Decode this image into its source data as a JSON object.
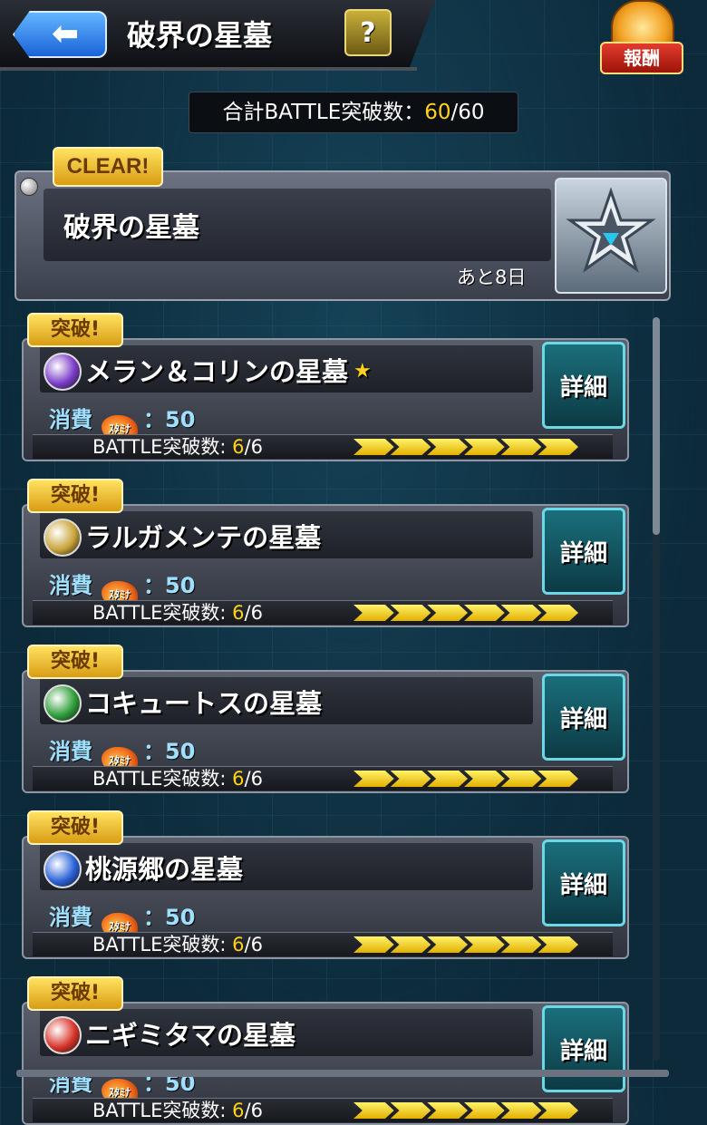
{
  "header": {
    "back_label": "⬅",
    "title": "破界の星墓",
    "help_label": "?",
    "reward_label": "報酬"
  },
  "total": {
    "label": "合計BATTLE突破数：",
    "current": "60",
    "max": "/60"
  },
  "event": {
    "clear_badge": "CLEAR!",
    "title": "破界の星墓",
    "remaining": "あと8日"
  },
  "stages": [
    {
      "badge": "突破!",
      "name": "メラン＆コリンの星墓",
      "star": "★",
      "cost_label": "消費",
      "stamina_text": "ｽﾀﾐﾅ",
      "cost_value": "：50",
      "battle_label": "BATTLE突破数: ",
      "battle_current": "6",
      "battle_max": "/6",
      "progress": 1.0,
      "detail_label": "詳細",
      "icon": "purple-element-icon",
      "icon_color": "#7a3cc8"
    },
    {
      "badge": "突破!",
      "name": "ラルガメンテの星墓",
      "star": "",
      "cost_label": "消費",
      "stamina_text": "ｽﾀﾐﾅ",
      "cost_value": "：50",
      "battle_label": "BATTLE突破数: ",
      "battle_current": "6",
      "battle_max": "/6",
      "progress": 1.0,
      "detail_label": "詳細",
      "icon": "light-element-icon",
      "icon_color": "#c9a43a"
    },
    {
      "badge": "突破!",
      "name": "コキュートスの星墓",
      "star": "",
      "cost_label": "消費",
      "stamina_text": "ｽﾀﾐﾅ",
      "cost_value": "：50",
      "battle_label": "BATTLE突破数: ",
      "battle_current": "6",
      "battle_max": "/6",
      "progress": 1.0,
      "detail_label": "詳細",
      "icon": "wood-element-icon",
      "icon_color": "#2f9e3a"
    },
    {
      "badge": "突破!",
      "name": "桃源郷の星墓",
      "star": "",
      "cost_label": "消費",
      "stamina_text": "ｽﾀﾐﾅ",
      "cost_value": "：50",
      "battle_label": "BATTLE突破数: ",
      "battle_current": "6",
      "battle_max": "/6",
      "progress": 1.0,
      "detail_label": "詳細",
      "icon": "water-element-icon",
      "icon_color": "#2a62d8"
    },
    {
      "badge": "突破!",
      "name": "ニギミタマの星墓",
      "star": "",
      "cost_label": "消費",
      "stamina_text": "ｽﾀﾐﾅ",
      "cost_value": "：50",
      "battle_label": "BATTLE突破数: ",
      "battle_current": "6",
      "battle_max": "/6",
      "progress": 1.0,
      "detail_label": "詳細",
      "icon": "fire-element-icon",
      "icon_color": "#d8342a"
    }
  ]
}
